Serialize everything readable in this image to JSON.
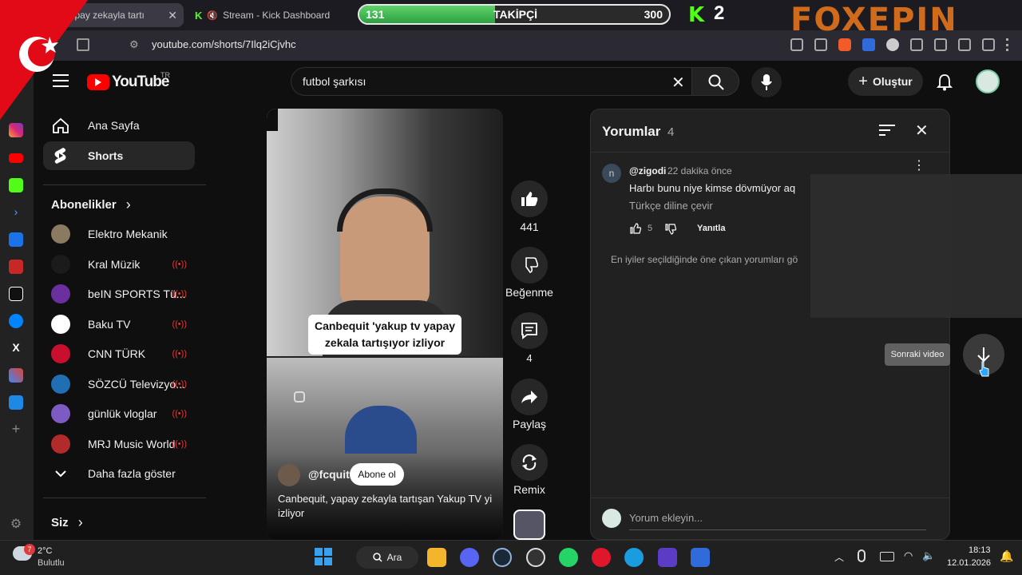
{
  "browser": {
    "tabs": [
      {
        "title": "Yapay zekayla tartı",
        "icon": "youtube-icon"
      },
      {
        "title": "Stream - Kick Dashboard",
        "icon": "kick-icon"
      }
    ],
    "url": "youtube.com/shorts/7Ilq2iCjvhc"
  },
  "overlay": {
    "followers_current": "131",
    "followers_label": "TAKİPÇİ",
    "followers_goal": "300",
    "follower_progress": 0.437,
    "kick_logo": "K",
    "kick_count": "2",
    "brand_watermark": "FOXEPIN"
  },
  "youtube": {
    "logo": "YouTube",
    "region": "TR",
    "search_value": "futbol şarkısı",
    "create_label": "Oluştur",
    "sidebar": {
      "home": "Ana Sayfa",
      "shorts": "Shorts",
      "subscriptions_title": "Abonelikler",
      "subscriptions": [
        {
          "name": "Elektro Mekanik",
          "live": false,
          "color": "#8a7a62"
        },
        {
          "name": "Kral Müzik",
          "live": true,
          "color": "#1b1b1b"
        },
        {
          "name": "beIN SPORTS Tü...",
          "live": true,
          "color": "#6b2fa0"
        },
        {
          "name": "Baku TV",
          "live": true,
          "color": "#ffffff"
        },
        {
          "name": "CNN TÜRK",
          "live": true,
          "color": "#c8102e"
        },
        {
          "name": "SÖZCÜ Televizyo...",
          "live": true,
          "color": "#1f6fb2"
        },
        {
          "name": "günlük vloglar",
          "live": true,
          "color": "#7e5bc2"
        },
        {
          "name": "MRJ Music World",
          "live": true,
          "color": "#b22a2a"
        }
      ],
      "show_more": "Daha fazla göster",
      "you": "Siz"
    },
    "short": {
      "caption_line1": "Canbequit 'yakup tv yapay",
      "caption_line2": "zekala tartışıyor izliyor",
      "channel": "@fcquit",
      "subscribe": "Abone ol",
      "title": "Canbequit, yapay zekayla tartışan Yakup TV yi izliyor",
      "likes": "441",
      "dislike_label": "Beğenme",
      "comments_count": "4",
      "share_label": "Paylaş",
      "remix_label": "Remix"
    },
    "comments_panel": {
      "title": "Yorumlar",
      "count": "4",
      "comment": {
        "author": "@zigodi",
        "time": "22 dakika önce",
        "text": "Harbı bunu niye kimse dövmüyor aq",
        "translate": "Türkçe diline çevir",
        "likes": "5",
        "reply": "Yanıtla",
        "avatar_letter": "n"
      },
      "notice": "En iyiler seçildiğinde öne çıkan yorumları gö",
      "add_placeholder": "Yorum ekleyin..."
    },
    "next_tooltip": "Sonraki video"
  },
  "taskbar": {
    "temp": "2°C",
    "weather": "Bulutlu",
    "weather_badge": "7",
    "search_label": "Ara",
    "time": "18:13",
    "date": "12.01.2026"
  }
}
